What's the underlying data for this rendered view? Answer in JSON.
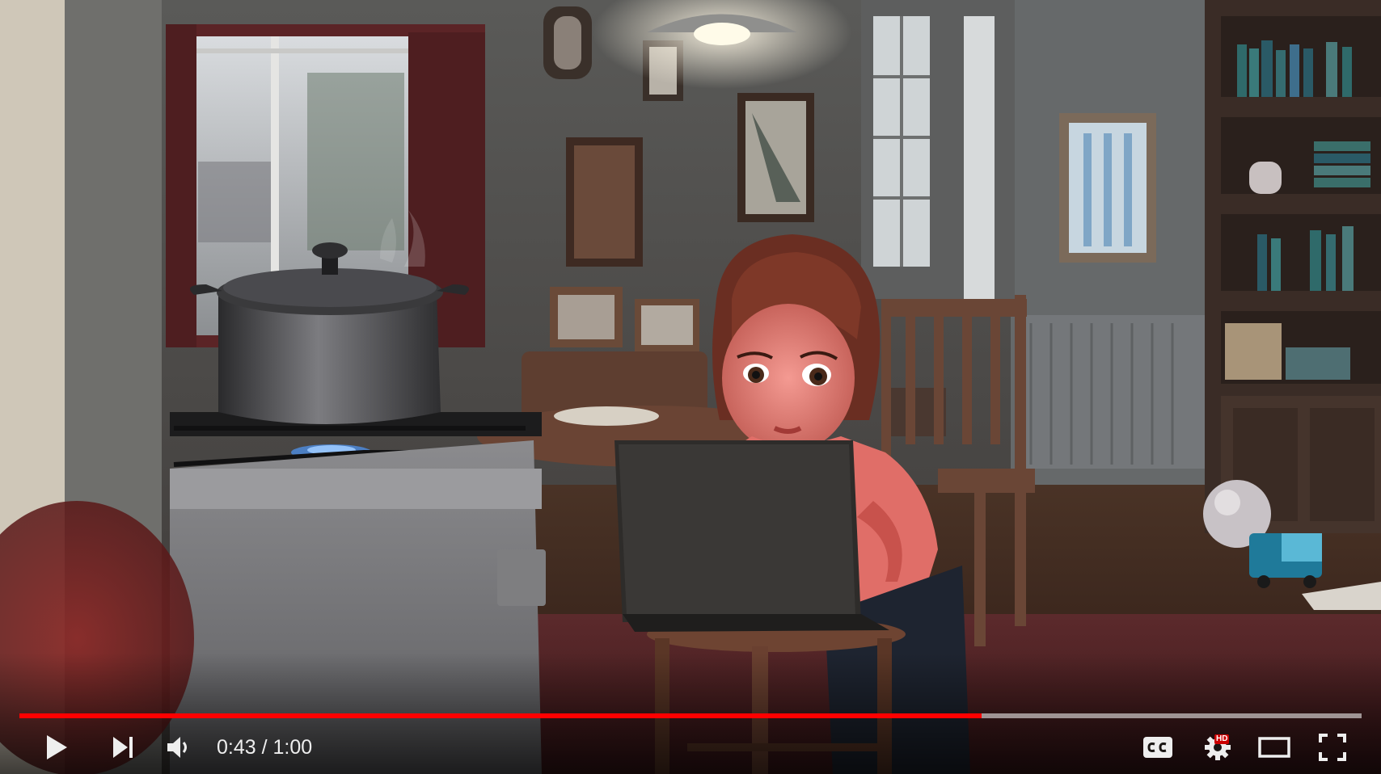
{
  "player": {
    "progress_fraction": 0.717,
    "time": {
      "current": "0:43",
      "separator": "/",
      "duration": "1:00"
    },
    "badge_hd": "HD",
    "controls": {
      "play_icon": "play-icon",
      "next_icon": "skip-next-icon",
      "volume_icon": "volume-icon",
      "cc_icon": "closed-captions-icon",
      "settings_icon": "gear-icon",
      "theater_icon": "theater-mode-icon",
      "fullscreen_icon": "fullscreen-icon"
    },
    "colors": {
      "progress_played": "#ff0000",
      "progress_track": "#b3b3b3",
      "hd_badge": "#cc0000",
      "control_fg": "#eeeeee"
    }
  }
}
